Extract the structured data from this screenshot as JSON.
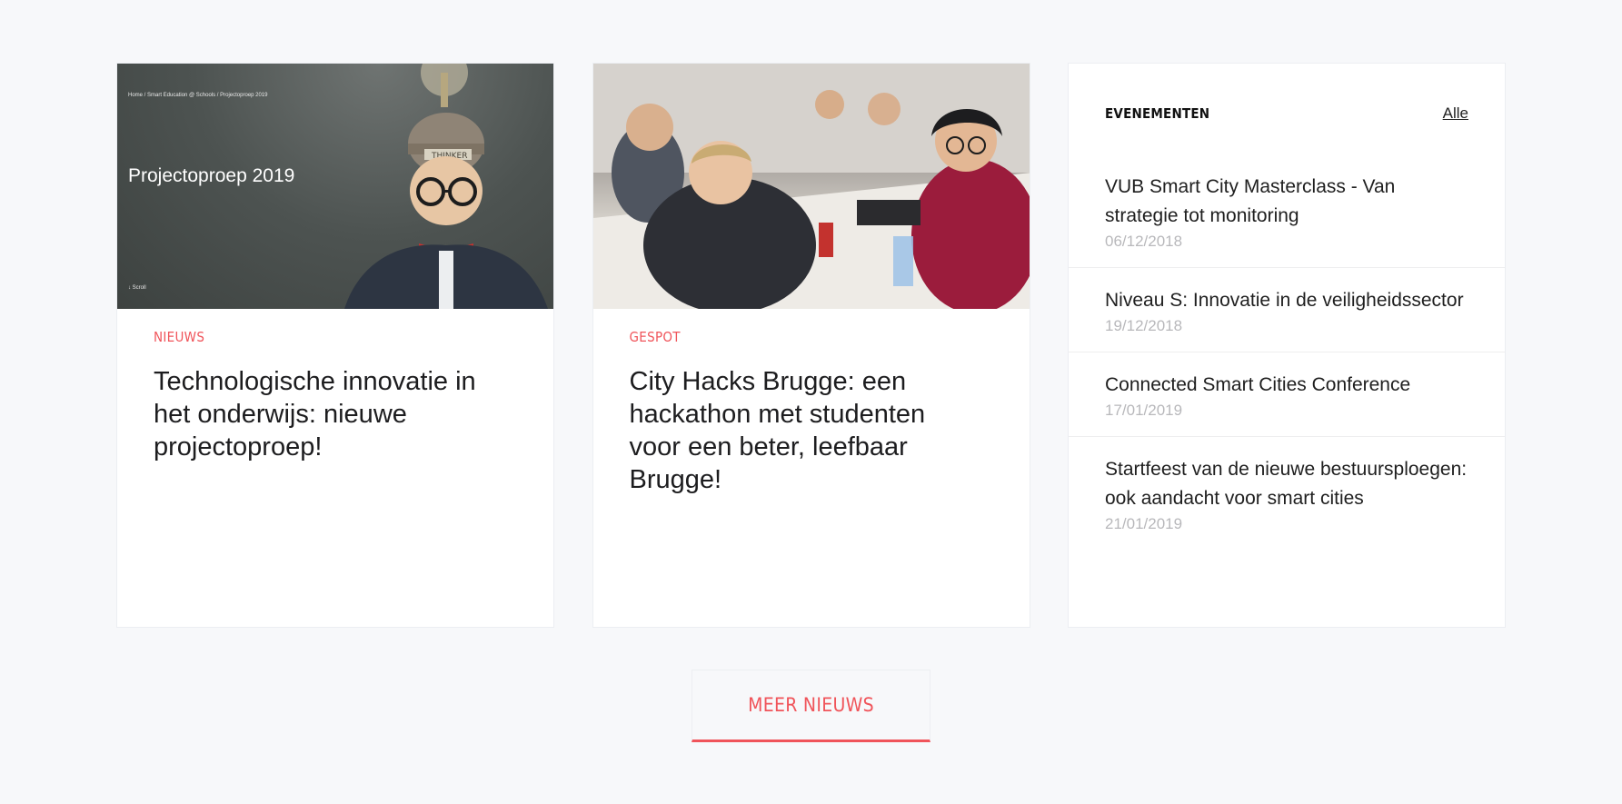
{
  "news_cards": [
    {
      "category": "NIEUWS",
      "title": "Technologische innovatie in het onderwijs: nieuwe projectoproep!",
      "image": {
        "breadcrumb": "Home / Smart Education @ Schools / Projectoproep 2019",
        "overlay_title": "Projectoproep 2019",
        "scroll_label": "Scroll"
      }
    },
    {
      "category": "GESPOT",
      "title": "City Hacks Brugge: een hackathon met studenten voor een beter, leefbaar Brugge!"
    }
  ],
  "events": {
    "title": "EVENEMENTEN",
    "all_link": "Alle",
    "items": [
      {
        "title": "VUB Smart City Masterclass - Van strategie tot monitoring",
        "date": "06/12/2018"
      },
      {
        "title": "Niveau S: Innovatie in de veiligheidssector",
        "date": "19/12/2018"
      },
      {
        "title": "Connected Smart Cities Conference",
        "date": "17/01/2019"
      },
      {
        "title": "Startfeest van de nieuwe bestuursploegen: ook aandacht voor smart cities",
        "date": "21/01/2019"
      }
    ]
  },
  "more_news_label": "MEER NIEUWS",
  "colors": {
    "accent": "#f0545a",
    "background": "#f7f8fa",
    "card": "#ffffff",
    "date": "#b8b8bb"
  }
}
